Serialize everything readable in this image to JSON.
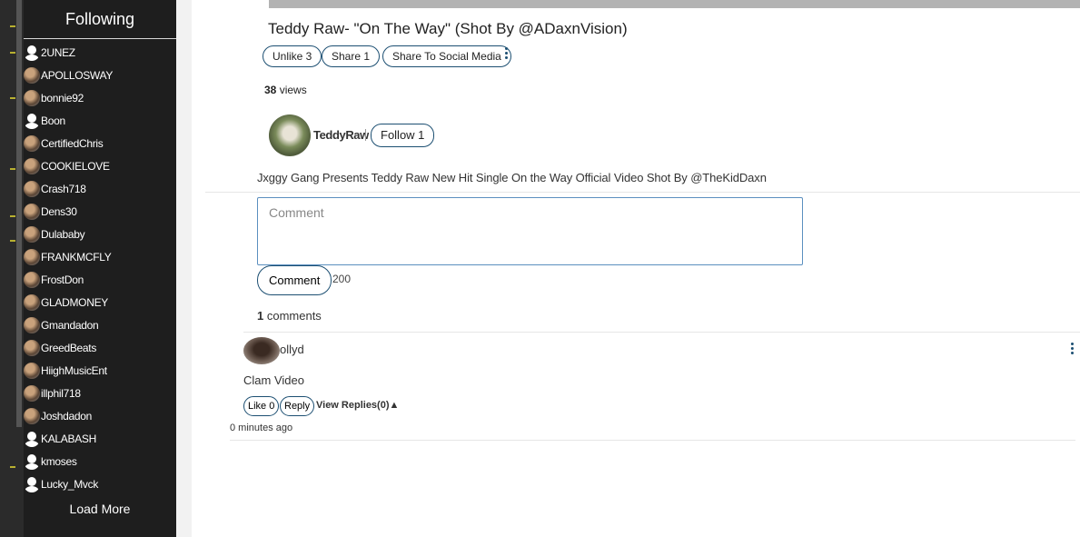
{
  "sidebar": {
    "title": "Following",
    "items": [
      {
        "name": "2UNEZ",
        "avatar": "default"
      },
      {
        "name": "APOLLOSWAY",
        "avatar": "photo"
      },
      {
        "name": "bonnie92",
        "avatar": "photo"
      },
      {
        "name": "Boon",
        "avatar": "default"
      },
      {
        "name": "CertifiedChris",
        "avatar": "photo"
      },
      {
        "name": "COOKIELOVE",
        "avatar": "photo"
      },
      {
        "name": "Crash718",
        "avatar": "photo"
      },
      {
        "name": "Dens30",
        "avatar": "photo"
      },
      {
        "name": "Dulababy",
        "avatar": "photo"
      },
      {
        "name": "FRANKMCFLY",
        "avatar": "photo"
      },
      {
        "name": "FrostDon",
        "avatar": "photo"
      },
      {
        "name": "GLADMONEY",
        "avatar": "photo"
      },
      {
        "name": "Gmandadon",
        "avatar": "photo"
      },
      {
        "name": "GreedBeats",
        "avatar": "photo"
      },
      {
        "name": "HiighMusicEnt",
        "avatar": "photo"
      },
      {
        "name": "illphil718",
        "avatar": "photo"
      },
      {
        "name": "Joshdadon",
        "avatar": "photo"
      },
      {
        "name": "KALABASH",
        "avatar": "default"
      },
      {
        "name": "kmoses",
        "avatar": "default"
      },
      {
        "name": "Lucky_Mvck",
        "avatar": "default"
      }
    ],
    "load_more": "Load More"
  },
  "video": {
    "title": "Teddy Raw- \"On The Way\" (Shot By @ADaxnVision)",
    "unlike_label": "Unlike 3",
    "share_label": "Share 1",
    "share_social_label": "Share To Social Media",
    "views_count": "38",
    "views_label": " views",
    "uploader": "TeddyRaw",
    "follow_label": "Follow 1",
    "description": "Jxggy Gang Presents Teddy Raw New Hit Single On the Way Official Video Shot By @TheKidDaxn"
  },
  "comment_form": {
    "placeholder": "Comment",
    "button_label": "Comment",
    "char_limit": "200"
  },
  "comments": {
    "count": "1",
    "count_label": " comments",
    "items": [
      {
        "user": "ollyd",
        "text": "Clam Video",
        "like_label": "Like 0",
        "reply_label": "Reply",
        "view_replies": "View Replies(0)▲",
        "time": "0 minutes ago"
      }
    ]
  }
}
